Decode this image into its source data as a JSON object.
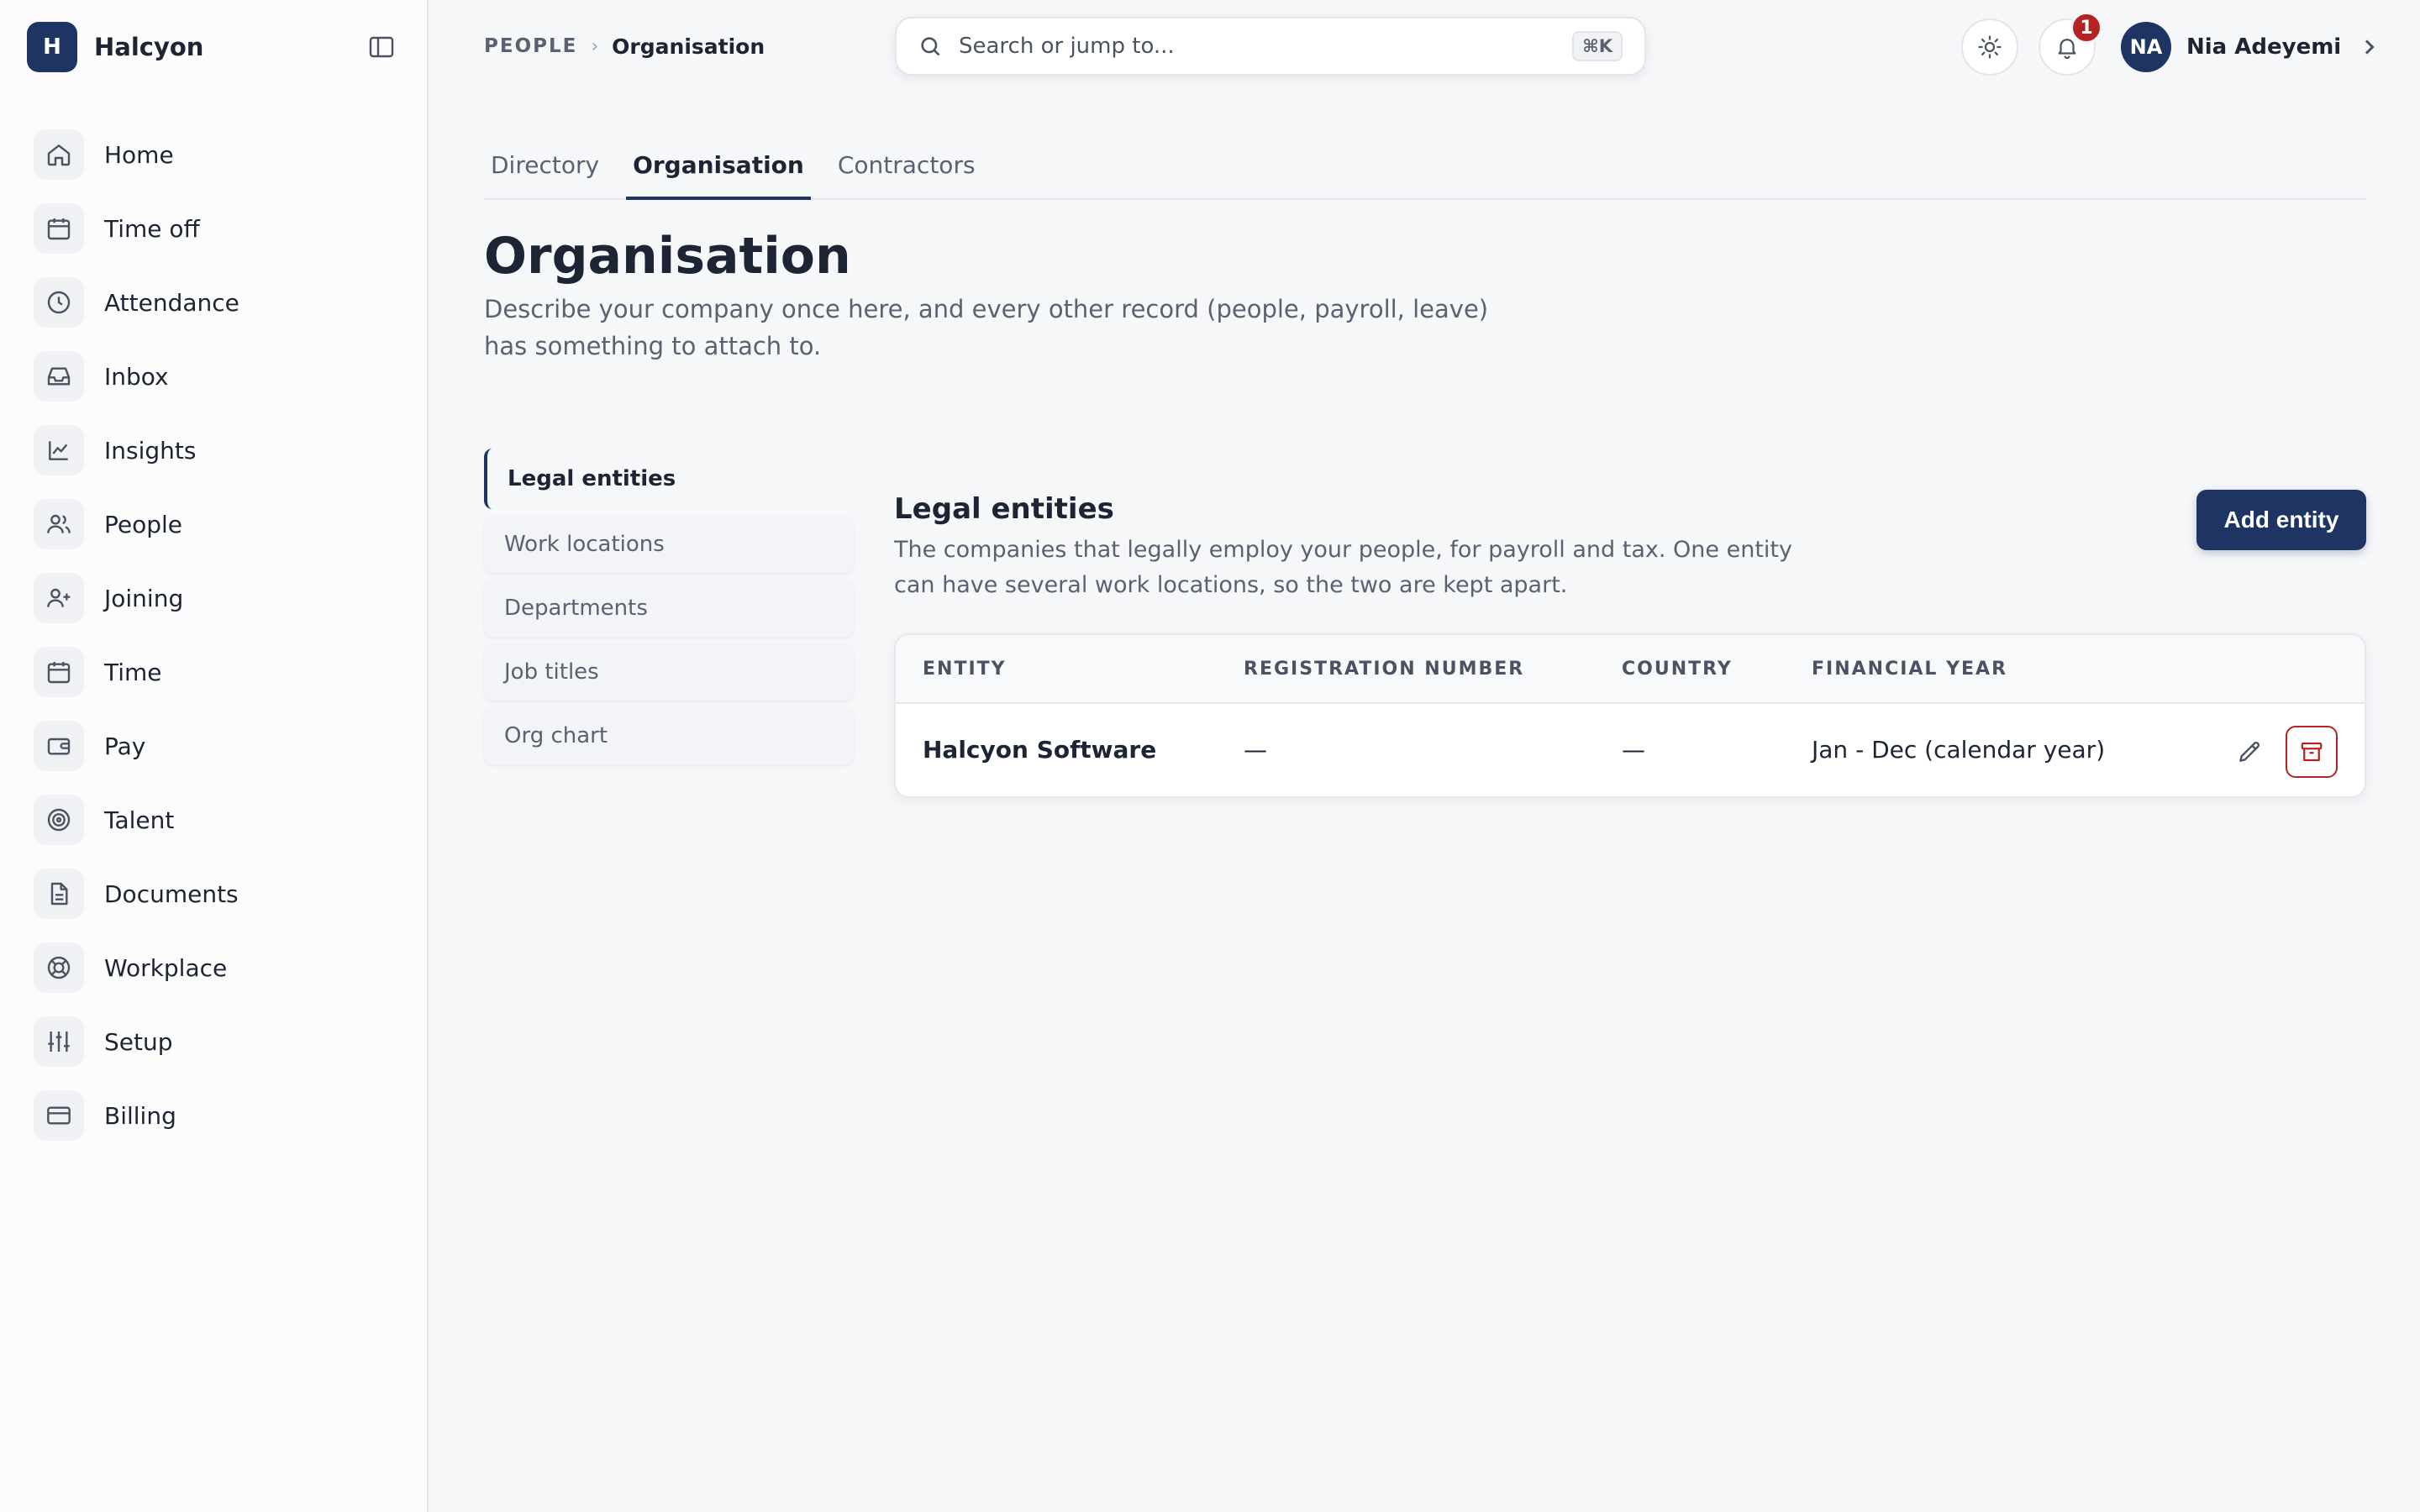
{
  "app": {
    "brand_initial": "H",
    "brand_name": "Halcyon"
  },
  "sidebar": {
    "items": [
      {
        "label": "Home",
        "icon": "home-icon"
      },
      {
        "label": "Time off",
        "icon": "calendar-icon"
      },
      {
        "label": "Attendance",
        "icon": "clock-icon"
      },
      {
        "label": "Inbox",
        "icon": "inbox-icon"
      },
      {
        "label": "Insights",
        "icon": "chart-line-icon"
      },
      {
        "label": "People",
        "icon": "users-icon"
      },
      {
        "label": "Joining",
        "icon": "user-plus-icon"
      },
      {
        "label": "Time",
        "icon": "calendar-icon"
      },
      {
        "label": "Pay",
        "icon": "wallet-icon"
      },
      {
        "label": "Talent",
        "icon": "target-icon"
      },
      {
        "label": "Documents",
        "icon": "document-icon"
      },
      {
        "label": "Workplace",
        "icon": "lifebuoy-icon"
      },
      {
        "label": "Setup",
        "icon": "sliders-icon"
      },
      {
        "label": "Billing",
        "icon": "credit-card-icon"
      }
    ]
  },
  "breadcrumb": {
    "parent": "PEOPLE",
    "current": "Organisation"
  },
  "search": {
    "placeholder": "Search or jump to...",
    "shortcut": "⌘K"
  },
  "header": {
    "notification_count": "1",
    "user_initials": "NA",
    "user_name": "Nia Adeyemi"
  },
  "tabs": [
    {
      "label": "Directory",
      "active": false
    },
    {
      "label": "Organisation",
      "active": true
    },
    {
      "label": "Contractors",
      "active": false
    }
  ],
  "page": {
    "title": "Organisation",
    "description": "Describe your company once here, and every other record (people, payroll, leave) has something to attach to."
  },
  "subnav": [
    {
      "label": "Legal entities",
      "active": true
    },
    {
      "label": "Work locations",
      "active": false
    },
    {
      "label": "Departments",
      "active": false
    },
    {
      "label": "Job titles",
      "active": false
    },
    {
      "label": "Org chart",
      "active": false
    }
  ],
  "section": {
    "title": "Legal entities",
    "description": "The companies that legally employ your people, for payroll and tax. One entity can have several work locations, so the two are kept apart.",
    "add_label": "Add entity"
  },
  "table": {
    "columns": [
      "ENTITY",
      "REGISTRATION NUMBER",
      "COUNTRY",
      "FINANCIAL YEAR"
    ],
    "rows": [
      {
        "entity": "Halcyon Software",
        "registration": "—",
        "country": "—",
        "financial_year": "Jan - Dec (calendar year)"
      }
    ]
  },
  "colors": {
    "brand": "#1e3563",
    "danger": "#b42323"
  }
}
